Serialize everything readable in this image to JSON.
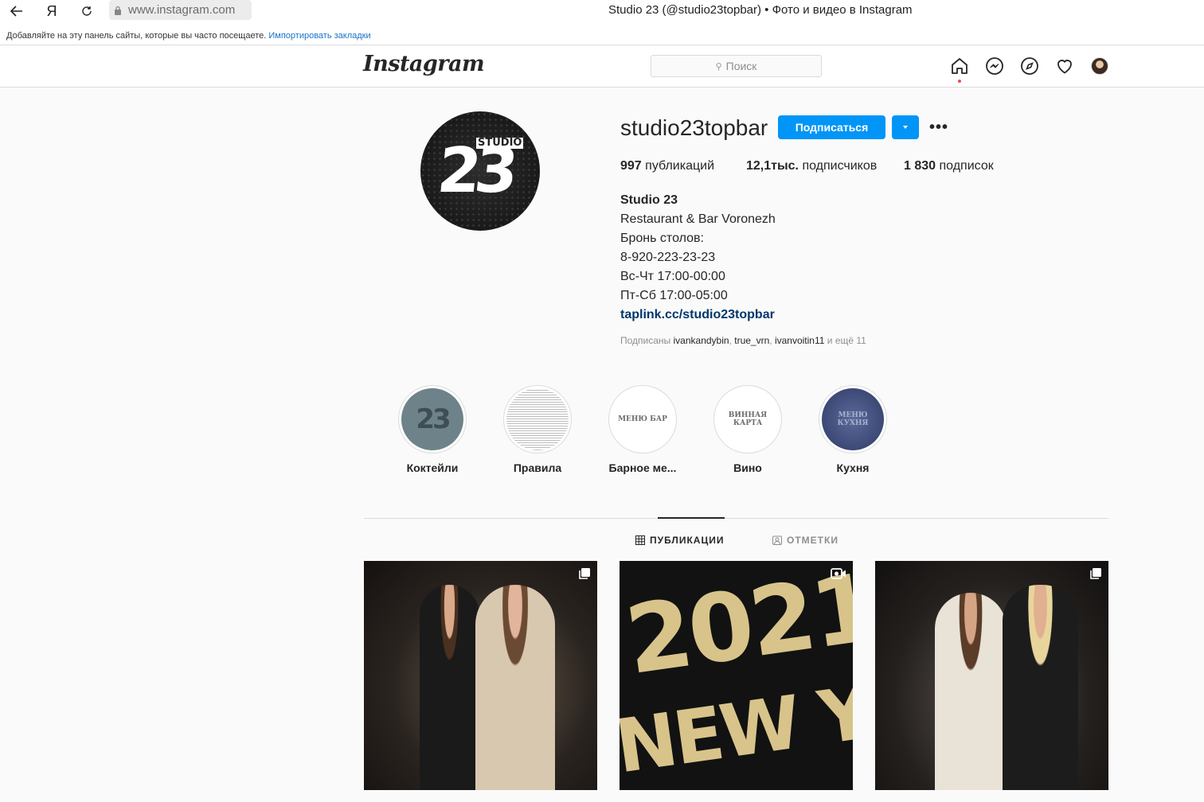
{
  "browser": {
    "url": "www.instagram.com",
    "tab_title": "Studio 23 (@studio23topbar) • Фото и видео в Instagram",
    "yandex_label": "Я",
    "bookmark_hint": "Добавляйте на эту панель сайты, которые вы часто посещаете.",
    "bookmark_link": "Импортировать закладки"
  },
  "header": {
    "logo": "Instagram",
    "search_placeholder": "Поиск",
    "icons": [
      "home-icon",
      "messenger-icon",
      "explore-icon",
      "heart-icon",
      "avatar"
    ]
  },
  "profile": {
    "username": "studio23topbar",
    "follow_label": "Подписаться",
    "avatar_number": "23",
    "avatar_word": "STUDIO",
    "stats": {
      "posts_value": "997",
      "posts_label": "публикаций",
      "followers_value": "12,1тыс.",
      "followers_label": "подписчиков",
      "following_value": "1 830",
      "following_label": "подписок"
    },
    "bio": {
      "name": "Studio 23",
      "line1": "Restaurant & Bar Voronezh",
      "line2": "Бронь столов:",
      "line3": "8-920-223-23-23",
      "line4": "Вс-Чт 17:00-00:00",
      "line5": "Пт-Сб 17:00-05:00",
      "link": "taplink.cc/studio23topbar"
    },
    "followed_by": {
      "prefix": "Подписаны",
      "user1": "ivankandybin",
      "user2": "true_vrn",
      "user3": "ivanvoitin11",
      "suffix": "и ещё 11"
    }
  },
  "highlights": [
    {
      "label": "Коктейли",
      "cover_text": "STUDIO 23"
    },
    {
      "label": "Правила",
      "cover_text": ""
    },
    {
      "label": "Барное ме...",
      "cover_text": "МЕНЮ БАР"
    },
    {
      "label": "Вино",
      "cover_text": "ВИННАЯ КАРТА"
    },
    {
      "label": "Кухня",
      "cover_text": "МЕНЮ КУХНЯ"
    }
  ],
  "tabs": [
    {
      "label": "ПУБЛИКАЦИИ",
      "active": true
    },
    {
      "label": "ОТМЕТКИ",
      "active": false
    }
  ],
  "posts": [
    {
      "type": "carousel",
      "text": ""
    },
    {
      "type": "video",
      "text_line1": "2021",
      "text_line2": "NEW YEA"
    },
    {
      "type": "carousel",
      "text": ""
    }
  ]
}
